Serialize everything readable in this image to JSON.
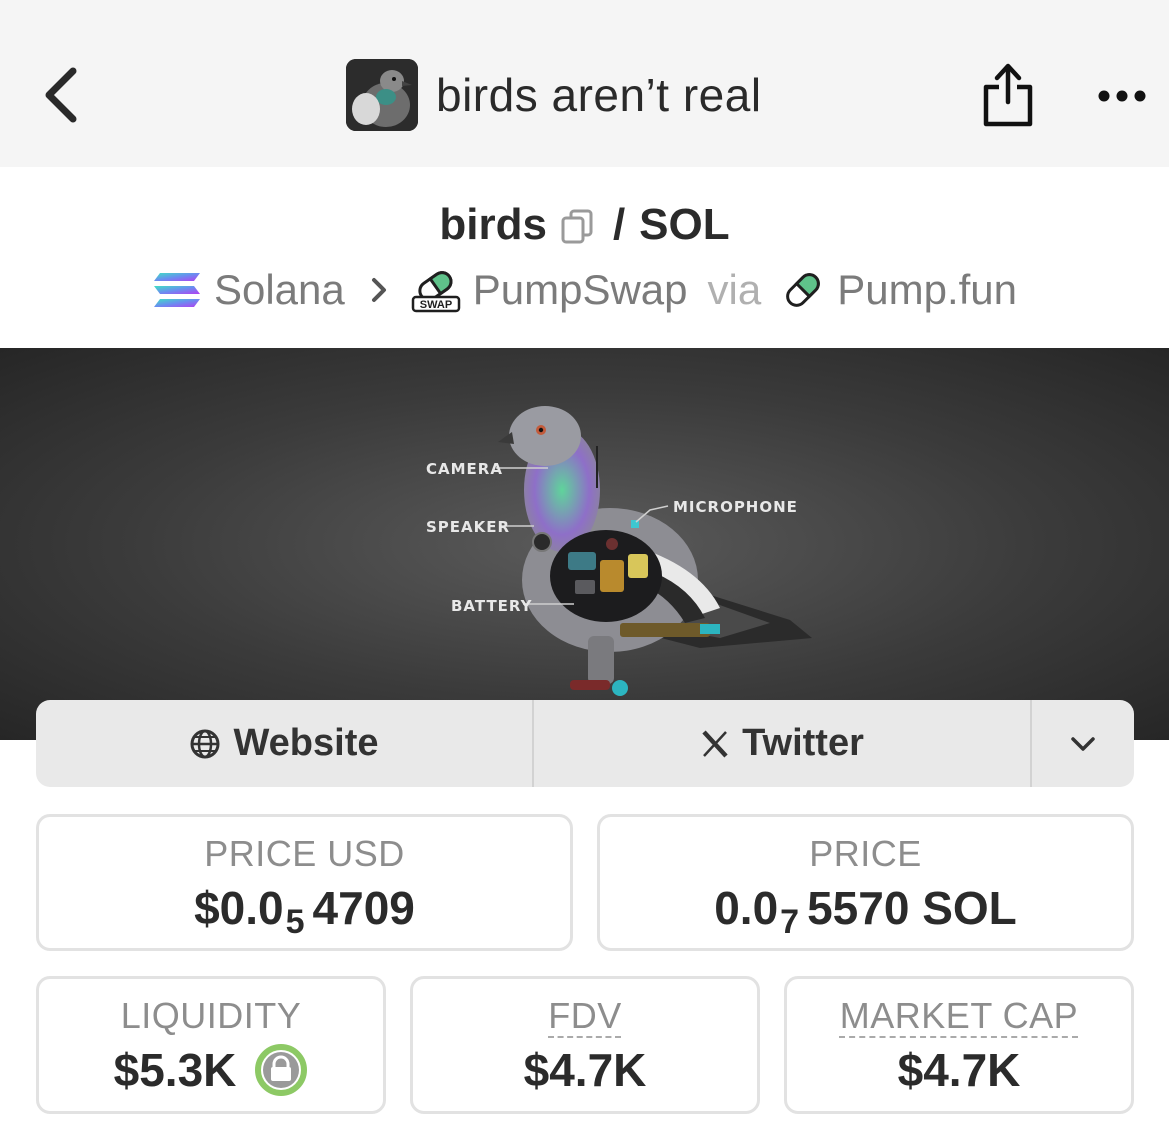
{
  "header": {
    "title": "birds aren’t real",
    "back_icon": "chevron-left-icon",
    "share_icon": "share-icon",
    "more_icon": "more-horizontal-icon"
  },
  "pair": {
    "base": "birds",
    "separator": "/",
    "quote": "SOL",
    "copy_icon": "copy-icon"
  },
  "breadcrumb": {
    "chain": "Solana",
    "dex": "PumpSwap",
    "via_label": "via",
    "launchpad": "Pump.fun"
  },
  "banner": {
    "labels": {
      "camera": "CAMERA",
      "speaker": "SPEAKER",
      "battery": "BATTERY",
      "microphone": "MICROPHONE"
    }
  },
  "links": {
    "website": "Website",
    "twitter": "Twitter"
  },
  "stats": {
    "price_usd": {
      "label": "PRICE USD",
      "prefix": "$0.0",
      "zeros": "5",
      "digits": "4709"
    },
    "price": {
      "label": "PRICE",
      "prefix": "0.0",
      "zeros": "7",
      "digits": "5570 SOL"
    },
    "liquidity": {
      "label": "LIQUIDITY",
      "value": "$5.3K"
    },
    "fdv": {
      "label": "FDV",
      "value": "$4.7K"
    },
    "market_cap": {
      "label": "MARKET CAP",
      "value": "$4.7K"
    }
  },
  "colors": {
    "liquidity_lock": "#8dc965",
    "pump_green": "#4bb27a"
  }
}
